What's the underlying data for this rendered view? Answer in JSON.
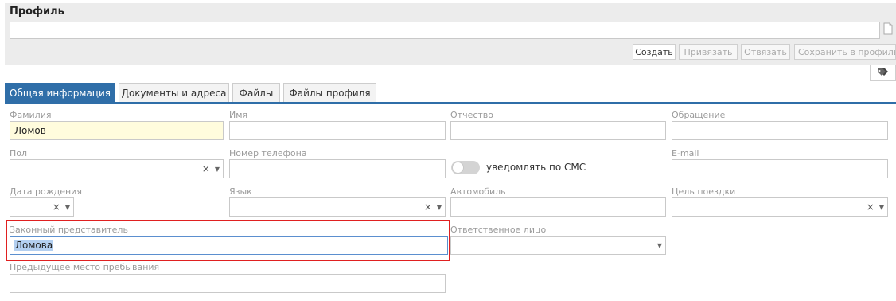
{
  "profile": {
    "title": "Профиль",
    "input_value": "",
    "buttons": {
      "create": "Создать",
      "bind": "Привязать",
      "unbind": "Отвязать",
      "save": "Сохранить в профиль"
    },
    "tag_icon": "tags-icon",
    "doc_icon": "document-icon"
  },
  "tabs": [
    {
      "label": "Общая информация",
      "active": true
    },
    {
      "label": "Документы и адреса",
      "active": false
    },
    {
      "label": "Файлы",
      "active": false
    },
    {
      "label": "Файлы профиля",
      "active": false
    }
  ],
  "form": {
    "last_name": {
      "label": "Фамилия",
      "value": "Ломов"
    },
    "first_name": {
      "label": "Имя",
      "value": ""
    },
    "patronymic": {
      "label": "Отчество",
      "value": ""
    },
    "salutation": {
      "label": "Обращение",
      "value": ""
    },
    "gender": {
      "label": "Пол",
      "value": ""
    },
    "phone": {
      "label": "Номер телефона",
      "value": ""
    },
    "sms_notify": {
      "label": "уведомлять по СМС",
      "on": false
    },
    "email": {
      "label": "E-mail",
      "value": ""
    },
    "birth_date": {
      "label": "Дата рождения",
      "value": ""
    },
    "language": {
      "label": "Язык",
      "value": ""
    },
    "car": {
      "label": "Автомобиль",
      "value": ""
    },
    "trip_purpose": {
      "label": "Цель поездки",
      "value": ""
    },
    "legal_rep": {
      "label": "Законный представитель",
      "value": "Ломова"
    },
    "responsible": {
      "label": "Ответственное лицо",
      "value": ""
    },
    "prev_stay": {
      "label": "Предыдущее место пребывания",
      "value": ""
    }
  },
  "colors": {
    "accent": "#2f6ea8",
    "highlight": "#e02020",
    "required_bg": "#fffcdd"
  }
}
